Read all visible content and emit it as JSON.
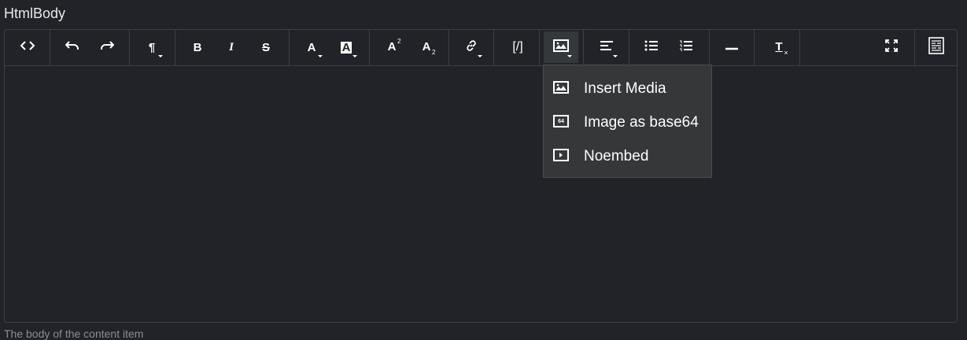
{
  "field": {
    "label": "HtmlBody",
    "hint": "The body of the content item"
  },
  "toolbar": {
    "buttons": [
      {
        "name": "source",
        "icon": "code-icon",
        "dropdown": false
      },
      {
        "name": "undo",
        "icon": "undo-icon",
        "dropdown": false
      },
      {
        "name": "redo",
        "icon": "redo-icon",
        "dropdown": false
      },
      {
        "name": "paragraph",
        "icon": "paragraph-icon",
        "glyph": "¶",
        "dropdown": true
      },
      {
        "name": "bold",
        "icon": "bold-icon",
        "glyph": "B",
        "dropdown": false
      },
      {
        "name": "italic",
        "icon": "italic-icon",
        "glyph": "I",
        "dropdown": false
      },
      {
        "name": "strikethrough",
        "icon": "strikethrough-icon",
        "glyph": "S",
        "dropdown": false
      },
      {
        "name": "font-color",
        "icon": "font-color-icon",
        "glyph": "A",
        "dropdown": true
      },
      {
        "name": "background-color",
        "icon": "background-color-icon",
        "glyph": "A",
        "dropdown": true
      },
      {
        "name": "superscript",
        "icon": "superscript-icon",
        "glyph": "A",
        "sub": "2",
        "dropdown": false
      },
      {
        "name": "subscript",
        "icon": "subscript-icon",
        "glyph": "A",
        "sub": "2",
        "dropdown": false
      },
      {
        "name": "link",
        "icon": "link-icon",
        "dropdown": true
      },
      {
        "name": "shortcode",
        "icon": "shortcode-icon",
        "glyph": "[/]",
        "dropdown": false
      },
      {
        "name": "image",
        "icon": "image-icon",
        "dropdown": true,
        "active": true
      },
      {
        "name": "align",
        "icon": "align-left-icon",
        "dropdown": true
      },
      {
        "name": "bullet-list",
        "icon": "bullet-list-icon",
        "dropdown": false
      },
      {
        "name": "numbered-list",
        "icon": "numbered-list-icon",
        "dropdown": false
      },
      {
        "name": "horizontal-rule",
        "icon": "horizontal-rule-icon",
        "dropdown": false
      },
      {
        "name": "clear-format",
        "icon": "clear-format-icon",
        "glyph": "T",
        "dropdown": false
      },
      {
        "name": "fullscreen",
        "icon": "fullscreen-icon",
        "dropdown": false
      },
      {
        "name": "preview",
        "icon": "preview-icon",
        "dropdown": false
      }
    ]
  },
  "media_menu": {
    "items": [
      {
        "label": "Insert Media",
        "icon": "image-icon"
      },
      {
        "label": "Image as base64",
        "icon": "base64-image-icon",
        "badge": "64"
      },
      {
        "label": "Noembed",
        "icon": "video-embed-icon"
      }
    ]
  },
  "colors": {
    "background": "#212328",
    "border": "#3c3f45",
    "menu_background": "#363738",
    "active_button": "#34373c"
  }
}
